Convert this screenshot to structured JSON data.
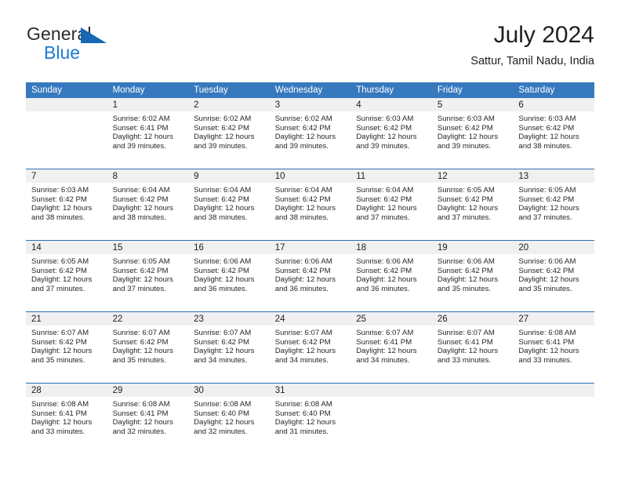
{
  "brand": {
    "word1": "General",
    "word2": "Blue",
    "triangle_color": "#1667b4",
    "word2_color": "#1a7ad4"
  },
  "header": {
    "title": "July 2024",
    "location": "Sattur, Tamil Nadu, India"
  },
  "theme": {
    "header_bg": "#3679bf",
    "row_divider": "#2f6fb5",
    "daynum_band": "#f0f0f0"
  },
  "weekday_headers": [
    "Sunday",
    "Monday",
    "Tuesday",
    "Wednesday",
    "Thursday",
    "Friday",
    "Saturday"
  ],
  "weeks": [
    [
      {
        "day": "",
        "lines": []
      },
      {
        "day": "1",
        "lines": [
          "Sunrise: 6:02 AM",
          "Sunset: 6:41 PM",
          "Daylight: 12 hours",
          "and 39 minutes."
        ]
      },
      {
        "day": "2",
        "lines": [
          "Sunrise: 6:02 AM",
          "Sunset: 6:42 PM",
          "Daylight: 12 hours",
          "and 39 minutes."
        ]
      },
      {
        "day": "3",
        "lines": [
          "Sunrise: 6:02 AM",
          "Sunset: 6:42 PM",
          "Daylight: 12 hours",
          "and 39 minutes."
        ]
      },
      {
        "day": "4",
        "lines": [
          "Sunrise: 6:03 AM",
          "Sunset: 6:42 PM",
          "Daylight: 12 hours",
          "and 39 minutes."
        ]
      },
      {
        "day": "5",
        "lines": [
          "Sunrise: 6:03 AM",
          "Sunset: 6:42 PM",
          "Daylight: 12 hours",
          "and 39 minutes."
        ]
      },
      {
        "day": "6",
        "lines": [
          "Sunrise: 6:03 AM",
          "Sunset: 6:42 PM",
          "Daylight: 12 hours",
          "and 38 minutes."
        ]
      }
    ],
    [
      {
        "day": "7",
        "lines": [
          "Sunrise: 6:03 AM",
          "Sunset: 6:42 PM",
          "Daylight: 12 hours",
          "and 38 minutes."
        ]
      },
      {
        "day": "8",
        "lines": [
          "Sunrise: 6:04 AM",
          "Sunset: 6:42 PM",
          "Daylight: 12 hours",
          "and 38 minutes."
        ]
      },
      {
        "day": "9",
        "lines": [
          "Sunrise: 6:04 AM",
          "Sunset: 6:42 PM",
          "Daylight: 12 hours",
          "and 38 minutes."
        ]
      },
      {
        "day": "10",
        "lines": [
          "Sunrise: 6:04 AM",
          "Sunset: 6:42 PM",
          "Daylight: 12 hours",
          "and 38 minutes."
        ]
      },
      {
        "day": "11",
        "lines": [
          "Sunrise: 6:04 AM",
          "Sunset: 6:42 PM",
          "Daylight: 12 hours",
          "and 37 minutes."
        ]
      },
      {
        "day": "12",
        "lines": [
          "Sunrise: 6:05 AM",
          "Sunset: 6:42 PM",
          "Daylight: 12 hours",
          "and 37 minutes."
        ]
      },
      {
        "day": "13",
        "lines": [
          "Sunrise: 6:05 AM",
          "Sunset: 6:42 PM",
          "Daylight: 12 hours",
          "and 37 minutes."
        ]
      }
    ],
    [
      {
        "day": "14",
        "lines": [
          "Sunrise: 6:05 AM",
          "Sunset: 6:42 PM",
          "Daylight: 12 hours",
          "and 37 minutes."
        ]
      },
      {
        "day": "15",
        "lines": [
          "Sunrise: 6:05 AM",
          "Sunset: 6:42 PM",
          "Daylight: 12 hours",
          "and 37 minutes."
        ]
      },
      {
        "day": "16",
        "lines": [
          "Sunrise: 6:06 AM",
          "Sunset: 6:42 PM",
          "Daylight: 12 hours",
          "and 36 minutes."
        ]
      },
      {
        "day": "17",
        "lines": [
          "Sunrise: 6:06 AM",
          "Sunset: 6:42 PM",
          "Daylight: 12 hours",
          "and 36 minutes."
        ]
      },
      {
        "day": "18",
        "lines": [
          "Sunrise: 6:06 AM",
          "Sunset: 6:42 PM",
          "Daylight: 12 hours",
          "and 36 minutes."
        ]
      },
      {
        "day": "19",
        "lines": [
          "Sunrise: 6:06 AM",
          "Sunset: 6:42 PM",
          "Daylight: 12 hours",
          "and 35 minutes."
        ]
      },
      {
        "day": "20",
        "lines": [
          "Sunrise: 6:06 AM",
          "Sunset: 6:42 PM",
          "Daylight: 12 hours",
          "and 35 minutes."
        ]
      }
    ],
    [
      {
        "day": "21",
        "lines": [
          "Sunrise: 6:07 AM",
          "Sunset: 6:42 PM",
          "Daylight: 12 hours",
          "and 35 minutes."
        ]
      },
      {
        "day": "22",
        "lines": [
          "Sunrise: 6:07 AM",
          "Sunset: 6:42 PM",
          "Daylight: 12 hours",
          "and 35 minutes."
        ]
      },
      {
        "day": "23",
        "lines": [
          "Sunrise: 6:07 AM",
          "Sunset: 6:42 PM",
          "Daylight: 12 hours",
          "and 34 minutes."
        ]
      },
      {
        "day": "24",
        "lines": [
          "Sunrise: 6:07 AM",
          "Sunset: 6:42 PM",
          "Daylight: 12 hours",
          "and 34 minutes."
        ]
      },
      {
        "day": "25",
        "lines": [
          "Sunrise: 6:07 AM",
          "Sunset: 6:41 PM",
          "Daylight: 12 hours",
          "and 34 minutes."
        ]
      },
      {
        "day": "26",
        "lines": [
          "Sunrise: 6:07 AM",
          "Sunset: 6:41 PM",
          "Daylight: 12 hours",
          "and 33 minutes."
        ]
      },
      {
        "day": "27",
        "lines": [
          "Sunrise: 6:08 AM",
          "Sunset: 6:41 PM",
          "Daylight: 12 hours",
          "and 33 minutes."
        ]
      }
    ],
    [
      {
        "day": "28",
        "lines": [
          "Sunrise: 6:08 AM",
          "Sunset: 6:41 PM",
          "Daylight: 12 hours",
          "and 33 minutes."
        ]
      },
      {
        "day": "29",
        "lines": [
          "Sunrise: 6:08 AM",
          "Sunset: 6:41 PM",
          "Daylight: 12 hours",
          "and 32 minutes."
        ]
      },
      {
        "day": "30",
        "lines": [
          "Sunrise: 6:08 AM",
          "Sunset: 6:40 PM",
          "Daylight: 12 hours",
          "and 32 minutes."
        ]
      },
      {
        "day": "31",
        "lines": [
          "Sunrise: 6:08 AM",
          "Sunset: 6:40 PM",
          "Daylight: 12 hours",
          "and 31 minutes."
        ]
      },
      {
        "day": "",
        "lines": []
      },
      {
        "day": "",
        "lines": []
      },
      {
        "day": "",
        "lines": []
      }
    ]
  ]
}
